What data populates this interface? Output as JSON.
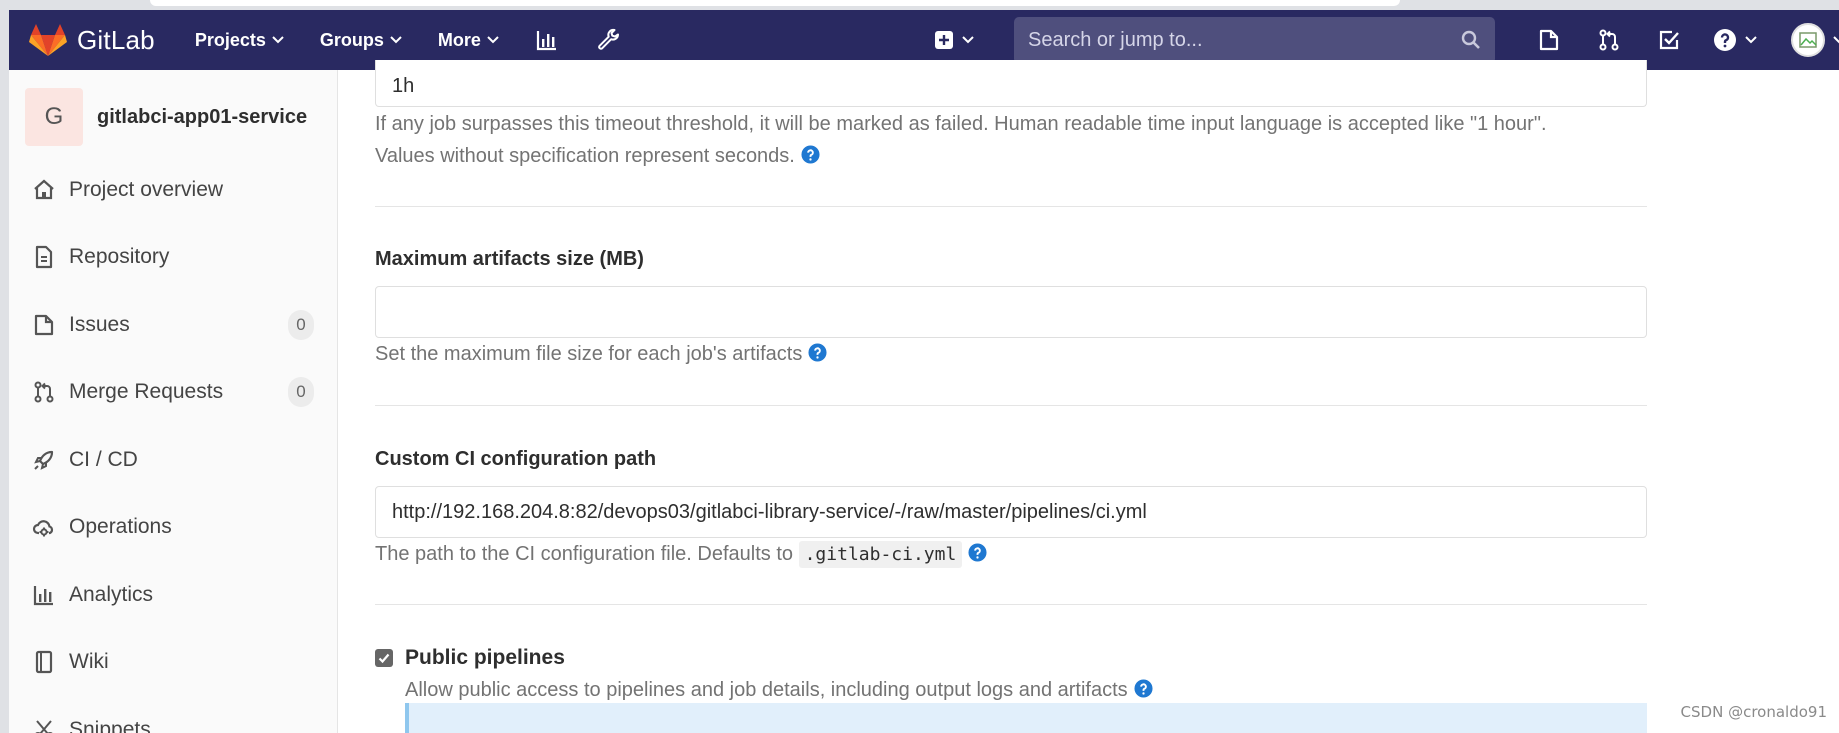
{
  "navbar": {
    "brand": "GitLab",
    "menu": [
      {
        "label": "Projects"
      },
      {
        "label": "Groups"
      },
      {
        "label": "More"
      }
    ],
    "search_placeholder": "Search or jump to..."
  },
  "sidebar": {
    "project_initial": "G",
    "project_name": "gitlabci-app01-service",
    "items": [
      {
        "label": "Project overview",
        "icon": "home-icon"
      },
      {
        "label": "Repository",
        "icon": "file-icon"
      },
      {
        "label": "Issues",
        "icon": "issues-icon",
        "count": "0"
      },
      {
        "label": "Merge Requests",
        "icon": "merge-request-icon",
        "count": "0"
      },
      {
        "label": "CI / CD",
        "icon": "rocket-icon"
      },
      {
        "label": "Operations",
        "icon": "cloud-gear-icon"
      },
      {
        "label": "Analytics",
        "icon": "chart-icon"
      },
      {
        "label": "Wiki",
        "icon": "book-icon"
      },
      {
        "label": "Snippets",
        "icon": "scissors-icon"
      }
    ]
  },
  "settings": {
    "timeout": {
      "value": "1h",
      "help_line1": "If any job surpasses this timeout threshold, it will be marked as failed. Human readable time input language is accepted like \"1 hour\".",
      "help_line2": "Values without specification represent seconds."
    },
    "max_artifacts": {
      "label": "Maximum artifacts size (MB)",
      "value": "",
      "help": "Set the maximum file size for each job's artifacts"
    },
    "ci_config_path": {
      "label": "Custom CI configuration path",
      "value": "http://192.168.204.8:82/devops03/gitlabci-library-service/-/raw/master/pipelines/ci.yml",
      "help_prefix": "The path to the CI configuration file. Defaults to",
      "help_code": ".gitlab-ci.yml"
    },
    "public_pipelines": {
      "label": "Public pipelines",
      "checked": true,
      "help": "Allow public access to pipelines and job details, including output logs and artifacts"
    }
  },
  "watermark": "CSDN @cronaldo91",
  "colors": {
    "navbar_bg": "#292961",
    "info_icon": "#1f78d1",
    "logo_orange": "#fc6d26"
  }
}
